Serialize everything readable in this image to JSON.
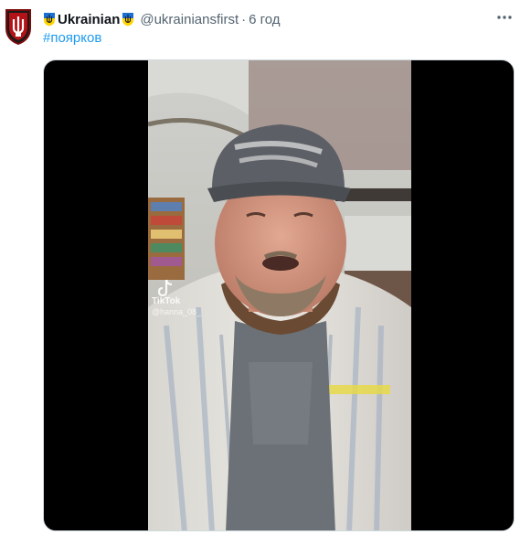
{
  "tweet": {
    "author_name": "Ukrainian",
    "handle": "@ukrainiansfirst",
    "time": "6 год",
    "hashtag": "#поярков"
  },
  "video": {
    "watermark_app": "TikTok",
    "watermark_user": "@hanna_08_"
  },
  "icons": {
    "avatar": "trident-shield-icon",
    "badge": "ukraine-shield-icon",
    "more": "more-icon"
  },
  "colors": {
    "accent": "#1d9bf0",
    "text": "#0f1419",
    "secondary": "#536471",
    "badge_blue": "#1c6fd1",
    "badge_yellow": "#ffd500"
  }
}
